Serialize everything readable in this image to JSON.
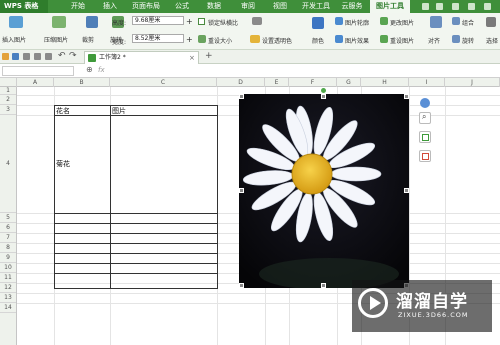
{
  "app": {
    "logo": "WPS 表格"
  },
  "menu": {
    "tabs": [
      "开始",
      "插入",
      "页面布局",
      "公式",
      "数据",
      "审阅",
      "视图",
      "开发工具",
      "云服务",
      "图片工具"
    ],
    "active": "图片工具"
  },
  "ribbon": {
    "insert_picture": "插入图片",
    "compress_picture": "压缩图片",
    "crop": "裁剪",
    "rotate": "旋转",
    "height_label": "高度:",
    "height_value": "9.68厘米",
    "width_label": "宽度:",
    "width_value": "8.52厘米",
    "lock_ratio": "锁定纵横比",
    "reset_size": "重设大小",
    "set_transparent": "设置透明色",
    "color": "颜色",
    "picture_outline": "图片轮廓",
    "change_picture": "更改图片",
    "picture_effects": "图片效果",
    "reset_picture": "重设图片",
    "align": "对齐",
    "group": "组合",
    "rotate2": "旋转",
    "select": "选择"
  },
  "doc_tab": {
    "name": "工作簿2 *"
  },
  "formula_bar": {
    "cell_ref": "",
    "fx": "fx"
  },
  "columns": [
    "A",
    "B",
    "C",
    "D",
    "E",
    "F",
    "G",
    "H",
    "I",
    "J"
  ],
  "rows": [
    "1",
    "2",
    "3",
    "4",
    "5",
    "6",
    "7",
    "8",
    "9",
    "10",
    "11",
    "12",
    "13",
    "14"
  ],
  "table": {
    "header_name": "花名",
    "header_picture": "图片",
    "flower_name": "菊花"
  },
  "watermark": {
    "brand": "溜溜自学",
    "url": "ZIXUE.3D66.COM"
  }
}
